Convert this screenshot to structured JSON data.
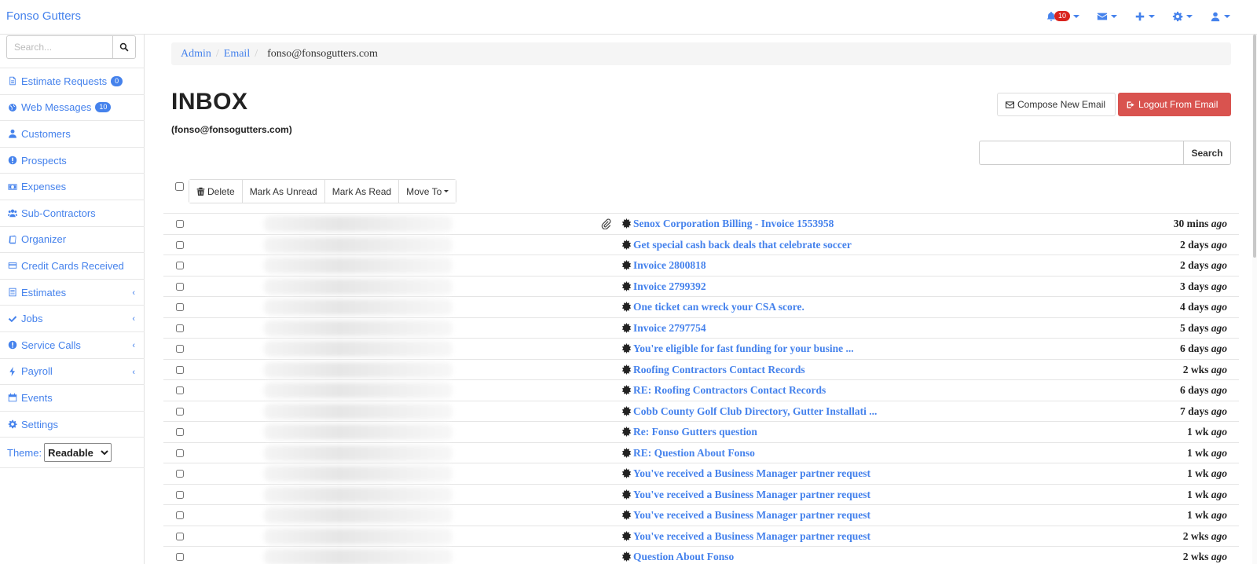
{
  "brand": "Fonso Gutters",
  "topnav": {
    "notifications_count": "10"
  },
  "sidebar": {
    "search_placeholder": "Search...",
    "items": [
      {
        "label": "Estimate Requests",
        "count": "0",
        "icon": "file-icon"
      },
      {
        "label": "Web Messages",
        "count": "10",
        "icon": "globe-icon"
      },
      {
        "label": "Customers",
        "icon": "user-icon"
      },
      {
        "label": "Prospects",
        "icon": "exclamation-circle-icon"
      },
      {
        "label": "Expenses",
        "icon": "money-icon"
      },
      {
        "label": "Sub-Contractors",
        "icon": "users-icon"
      },
      {
        "label": "Organizer",
        "icon": "book-icon"
      },
      {
        "label": "Credit Cards Received",
        "icon": "credit-card-icon"
      },
      {
        "label": "Estimates",
        "icon": "list-icon",
        "expandable": true
      },
      {
        "label": "Jobs",
        "icon": "check-icon",
        "expandable": true
      },
      {
        "label": "Service Calls",
        "icon": "exclamation-circle-icon",
        "expandable": true
      },
      {
        "label": "Payroll",
        "icon": "bolt-icon",
        "expandable": true
      },
      {
        "label": "Events",
        "icon": "calendar-icon"
      },
      {
        "label": "Settings",
        "icon": "gear-icon"
      }
    ],
    "theme_label": "Theme:",
    "theme_value": "Readable"
  },
  "breadcrumb": {
    "items": [
      "Admin",
      "Email"
    ],
    "active": "fonso@fonsogutters.com"
  },
  "page": {
    "title": "INBOX",
    "subtitle": "(fonso@fonsogutters.com)"
  },
  "actions": {
    "compose": "Compose New Email",
    "logout": "Logout From Email",
    "search_button": "Search"
  },
  "toolbar": {
    "delete": "Delete",
    "mark_unread": "Mark As Unread",
    "mark_read": "Mark As Read",
    "move_to": "Move To"
  },
  "emails": [
    {
      "subject": "Senox Corporation Billing - Invoice 1553958",
      "when": "30 mins",
      "ago": "ago",
      "attachment": true
    },
    {
      "subject": "Get special cash back deals that celebrate soccer",
      "when": "2 days",
      "ago": "ago"
    },
    {
      "subject": "Invoice 2800818",
      "when": "2 days",
      "ago": "ago"
    },
    {
      "subject": "Invoice 2799392",
      "when": "3 days",
      "ago": "ago"
    },
    {
      "subject": "One ticket can wreck your CSA score.",
      "when": "4 days",
      "ago": "ago"
    },
    {
      "subject": "Invoice 2797754",
      "when": "5 days",
      "ago": "ago"
    },
    {
      "subject": "You're eligible for fast funding for your busine ...",
      "when": "6 days",
      "ago": "ago"
    },
    {
      "subject": "Roofing Contractors Contact Records",
      "when": "2 wks",
      "ago": "ago"
    },
    {
      "subject": "RE: Roofing Contractors Contact Records",
      "when": "6 days",
      "ago": "ago"
    },
    {
      "subject": "Cobb County Golf Club Directory, Gutter Installati ...",
      "when": "7 days",
      "ago": "ago"
    },
    {
      "subject": "Re: Fonso Gutters question",
      "when": "1 wk",
      "ago": "ago"
    },
    {
      "subject": "RE: Question About Fonso",
      "when": "1 wk",
      "ago": "ago"
    },
    {
      "subject": "You've received a Business Manager partner request",
      "when": "1 wk",
      "ago": "ago"
    },
    {
      "subject": "You've received a Business Manager partner request",
      "when": "1 wk",
      "ago": "ago"
    },
    {
      "subject": "You've received a Business Manager partner request",
      "when": "1 wk",
      "ago": "ago"
    },
    {
      "subject": "You've received a Business Manager partner request",
      "when": "2 wks",
      "ago": "ago"
    },
    {
      "subject": "Question About Fonso",
      "when": "2 wks",
      "ago": "ago"
    }
  ],
  "colors": {
    "accent": "#4582ec",
    "danger": "#d9534f",
    "badge_red": "#d9231d"
  }
}
